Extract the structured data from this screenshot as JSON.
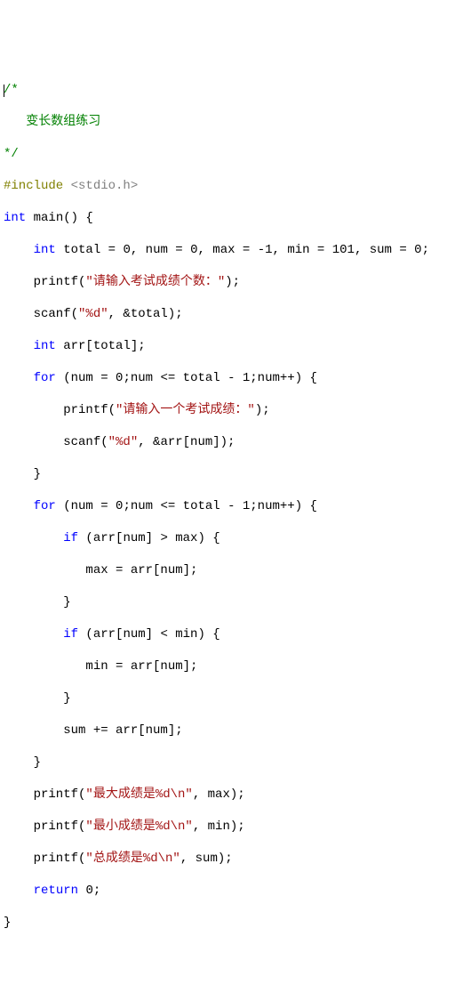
{
  "code": {
    "l1": {
      "a": "/*"
    },
    "l2": {
      "a": "   变长数组练习"
    },
    "l3": {
      "a": "*/"
    },
    "l4": {
      "a": "#include ",
      "b": "<stdio.h>"
    },
    "l5": {
      "a": "int",
      "b": " main() {"
    },
    "l6": {
      "a": "    ",
      "b": "int",
      "c": " total = ",
      "d": "0",
      "e": ", num = ",
      "f": "0",
      "g": ", max = -",
      "h": "1",
      "i": ", min = ",
      "j": "101",
      "k": ", sum = ",
      "l": "0",
      "m": ";"
    },
    "l7": {
      "a": "    printf(",
      "b": "\"请输入考试成绩个数：\"",
      "c": ");"
    },
    "l8": {
      "a": "    scanf(",
      "b": "\"%d\"",
      "c": ", &total);"
    },
    "l9": {
      "a": "    ",
      "b": "int",
      "c": " arr[total];"
    },
    "l10": {
      "a": "    ",
      "b": "for",
      "c": " (num = ",
      "d": "0",
      "e": ";num <= total - ",
      "f": "1",
      "g": ";num++) {"
    },
    "l11": {
      "a": "        printf(",
      "b": "\"请输入一个考试成绩：\"",
      "c": ");"
    },
    "l12": {
      "a": "        scanf(",
      "b": "\"%d\"",
      "c": ", &arr[num]);"
    },
    "l13": {
      "a": "    }"
    },
    "l14": {
      "a": "    ",
      "b": "for",
      "c": " (num = ",
      "d": "0",
      "e": ";num <= total - ",
      "f": "1",
      "g": ";num++) {"
    },
    "l15": {
      "a": "        ",
      "b": "if",
      "c": " (arr[num] > max) {"
    },
    "l16": {
      "a": "           max = arr[num];"
    },
    "l17": {
      "a": "        }"
    },
    "l18": {
      "a": "        ",
      "b": "if",
      "c": " (arr[num] < min) {"
    },
    "l19": {
      "a": "           min = arr[num];"
    },
    "l20": {
      "a": "        }"
    },
    "l21": {
      "a": "        sum += arr[num];"
    },
    "l22": {
      "a": "    }"
    },
    "l23": {
      "a": "    printf(",
      "b": "\"最大成绩是%d\\n\"",
      "c": ", max);"
    },
    "l24": {
      "a": "    printf(",
      "b": "\"最小成绩是%d\\n\"",
      "c": ", min);"
    },
    "l25": {
      "a": "    printf(",
      "b": "\"总成绩是%d\\n\"",
      "c": ", sum);"
    },
    "l26": {
      "a": "    ",
      "b": "return",
      "c": " ",
      "d": "0",
      "e": ";"
    },
    "l27": {
      "a": "}"
    }
  }
}
